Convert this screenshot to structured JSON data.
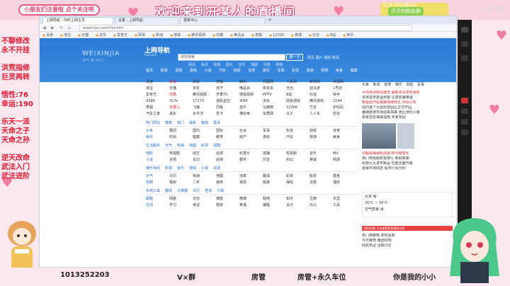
{
  "overlay": {
    "top_left_banner": "小朋友们注意啦 点个关注吧",
    "title": "欢迎来到开某人的直播间",
    "top_right_small": "早上好 今天也要加油",
    "top_right_badge": "开开的粉丝群",
    "logo": "Q 兜",
    "left_notes": [
      "不聊修改",
      "永不开挂",
      "洪荒指修",
      "巨灵再转",
      "悟性:76",
      "幸运:190",
      "乐天一派",
      "天命之子",
      "天命之孙",
      "逆天改命",
      "武法入门",
      "武法进阶"
    ],
    "bottom": {
      "qq": "1013252203",
      "vx": "V×群",
      "item3": "房管",
      "item4": "房管+永久车位",
      "item5": "你是我的小小"
    }
  },
  "browser": {
    "tabs": [
      {
        "label": "上网导航 - 你的上网主页"
      },
      {
        "label": "设置 - 上网导航"
      },
      {
        "label": "更新中心"
      }
    ],
    "url": "www.hao.com/?src=lm",
    "favorites": [
      "百度",
      "淘宝",
      "天猫",
      "京东",
      "爱奇艺",
      "网易",
      "新浪",
      "搜狐",
      "腾讯视频",
      "优酷",
      "唯品会",
      "携程",
      "12306",
      "微博",
      "抖音",
      "B站",
      "知乎"
    ]
  },
  "page": {
    "hero": {
      "name": "WEIXINJIA",
      "sub": "天气 晴 26°C",
      "logo": "上网导航",
      "logo_sub": "hao.com",
      "search_placeholder": "搜狗搜索",
      "search_button": "搜一下",
      "search_extra": "网页 图片 视频 新闻",
      "search_tabs": [
        "网页",
        "资讯",
        "视频",
        "图片",
        "音乐",
        "地图",
        "问答",
        "购物"
      ]
    },
    "channels": [
      "首页",
      "新闻",
      "视频",
      "游戏",
      "小说",
      "汽车",
      "财经",
      "体育",
      "娱乐",
      "军事",
      "彩票",
      "旅游",
      "购物",
      "美食",
      "健康"
    ],
    "rows": [
      [
        "百度",
        "新浪",
        "网易",
        "搜狐",
        "腾讯",
        "凤凰网",
        "人民网",
        "新华网",
        "央视网"
      ],
      [
        "淘宝",
        "天猫",
        "京东",
        "苏宁",
        "唯品会",
        "拼多多",
        "当当",
        "亚马逊",
        "1号店"
      ],
      [
        "爱奇艺",
        "优酷",
        "腾讯视频",
        "芒果TV",
        "搜狐视频",
        "PPTV",
        "B站",
        "抖音",
        "快手"
      ],
      [
        "4399",
        "7k7k",
        "17173",
        "游民星空",
        "3DM",
        "多玩",
        "网易游戏",
        "腾讯游戏",
        "2144"
      ],
      [
        "携程",
        "去哪儿",
        "飞猪",
        "同程",
        "途牛",
        "马蜂窝",
        "12306",
        "艺龙",
        "驴妈妈"
      ],
      [
        "汽车之家",
        "易车",
        "太平洋",
        "爱卡",
        "懂车帝",
        "车质网",
        "瓜子",
        "人人车",
        "优信"
      ]
    ],
    "sections": [
      {
        "title": "热门网址",
        "tabs": [
          "推荐",
          "热门",
          "最新",
          "精选",
          "更多"
        ]
      },
      {
        "title": "生活服务",
        "tabs": [
          "天气",
          "快递",
          "地图",
          "彩票",
          "招聘"
        ]
      },
      {
        "title": "娱乐休闲",
        "tabs": [
          "影视",
          "音乐",
          "游戏",
          "小说",
          "动漫"
        ]
      },
      {
        "title": "实用工具",
        "tabs": [
          "翻译",
          "计算器",
          "日历",
          "查询",
          "下载"
        ]
      }
    ],
    "section_rows": [
      [
        "头条",
        "要闻",
        "国内",
        "国际",
        "社会",
        "军事",
        "科技",
        "财经",
        "体育"
      ],
      [
        "娱乐",
        "时尚",
        "健康",
        "教育",
        "房产",
        "游戏",
        "汽车",
        "旅游",
        "美食"
      ],
      [
        "电影",
        "电视剧",
        "综艺",
        "动漫",
        "纪录片",
        "直播",
        "短视频",
        "音乐",
        "MV"
      ],
      [
        "小说",
        "言情",
        "玄幻",
        "武侠",
        "都市",
        "历史",
        "科幻",
        "悬疑",
        "网游"
      ],
      [
        "天气",
        "日历",
        "快递",
        "地图",
        "违章",
        "翻译",
        "彩票",
        "股票",
        "基金"
      ],
      [
        "招聘",
        "租房",
        "二手",
        "装修",
        "家政",
        "搬家",
        "保险",
        "贷款",
        "理财"
      ],
      [
        "邮箱",
        "网盘",
        "论坛",
        "博客",
        "微博",
        "贴吧",
        "知乎",
        "豆瓣",
        "天涯"
      ],
      [
        "在线",
        "学习",
        "考试",
        "题库",
        "英语",
        "编程",
        "设计",
        "办公",
        "工具"
      ]
    ],
    "right": {
      "tabs": [
        "头条",
        "新闻",
        "体育",
        "娱乐",
        "财经",
        "军事"
      ],
      "headlines": [
        "今日热点新闻速览 最新资讯实时更新",
        "多地发布高温预警 注意防暑降温",
        "新能源汽车销量持续增长 市场火热",
        "国内首个大型科技园区正式开园",
        "暑期旅游市场迎来高峰 景区预约火爆",
        "高考志愿填报指南 专家支招"
      ],
      "headlines2": [
        "中超联赛最新战报 积分榜变化",
        "热门电视剧收视排行 新剧来袭",
        "科技巨头发布新品 性能全面升级",
        "金融市场动态 股市行情分析"
      ],
      "weather": [
        "北京 晴",
        "26°C ~ 34°C",
        "空气质量 良"
      ],
      "ad": "限时优惠 点击查看更多精彩内容",
      "more_lines": [
        "热门搜索榜 实时更新",
        "今日推荐 精选好物",
        "网友热议 话题讨论"
      ]
    }
  }
}
